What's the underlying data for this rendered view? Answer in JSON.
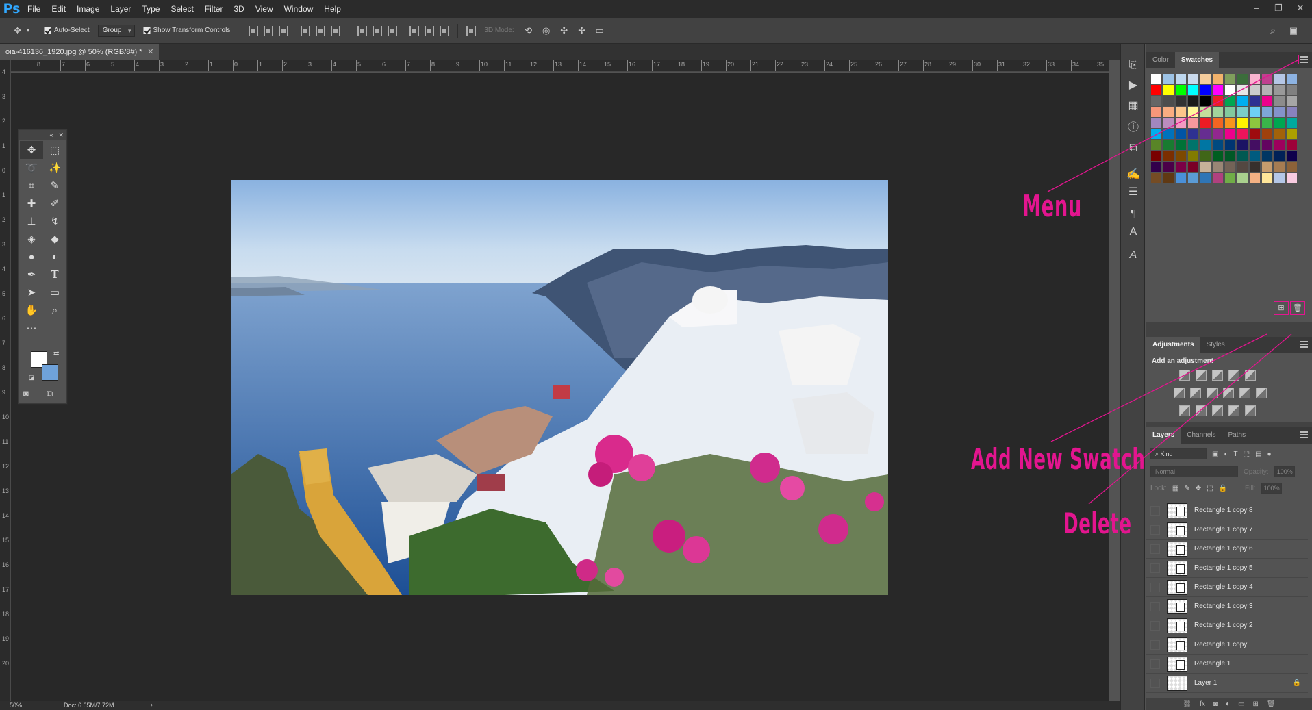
{
  "app": {
    "logo": "Ps"
  },
  "menubar": {
    "items": [
      "File",
      "Edit",
      "Image",
      "Layer",
      "Type",
      "Select",
      "Filter",
      "3D",
      "View",
      "Window",
      "Help"
    ]
  },
  "window_controls": [
    "–",
    "❐",
    "✕"
  ],
  "options_bar": {
    "auto_select_label": "Auto-Select",
    "auto_select_checked": true,
    "group_value": "Group",
    "show_transform_label": "Show Transform Controls",
    "show_transform_checked": true,
    "mode_3d_label": "3D Mode:"
  },
  "document": {
    "tab_title": "oia-416136_1920.jpg @ 50% (RGB/8#) *",
    "zoom": "50%",
    "doc_size": "Doc: 6.65M/7.72M"
  },
  "ruler": {
    "top_labels": [
      "8",
      "7",
      "6",
      "5",
      "4",
      "3",
      "2",
      "1",
      "0",
      "1",
      "2",
      "3",
      "4",
      "5",
      "6",
      "7",
      "8",
      "9",
      "10",
      "11",
      "12",
      "13",
      "14",
      "15",
      "16",
      "17",
      "18",
      "19",
      "20",
      "21",
      "22",
      "23",
      "24",
      "25",
      "26",
      "27",
      "28",
      "29",
      "30",
      "31",
      "32",
      "33",
      "34",
      "35"
    ],
    "left_labels": [
      "4",
      "3",
      "2",
      "1",
      "0",
      "1",
      "2",
      "3",
      "4",
      "5",
      "6",
      "7",
      "8",
      "9",
      "10",
      "11",
      "12",
      "13",
      "14",
      "15",
      "16",
      "17",
      "18",
      "19",
      "20"
    ]
  },
  "colors": {
    "foreground": "#ffffff",
    "background": "#6fa2da",
    "annotation": "#e3158f"
  },
  "swatches_panel": {
    "tabs": [
      "Color",
      "Swatches"
    ],
    "active_tab": "Swatches",
    "swatches": [
      "#ffffff",
      "#9dc3e6",
      "#bdd7ee",
      "#c9d9ec",
      "#f4cc9c",
      "#f2b26b",
      "#7f9e5c",
      "#3b6d3b",
      "#f8b4cf",
      "#c0408f",
      "#b5c7e6",
      "#8db3e2",
      "#ff0000",
      "#ffff00",
      "#00ff00",
      "#00ffff",
      "#0000ff",
      "#ff00ff",
      "#ffffff",
      "#e6e6e6",
      "#cccccc",
      "#b3b3b3",
      "#999999",
      "#808080",
      "#666666",
      "#4d4d4d",
      "#333333",
      "#1a1a1a",
      "#000000",
      "#ed1c24",
      "#00a651",
      "#00aeef",
      "#2e3192",
      "#ec008c",
      "#8c8c8c",
      "#a6a6a6",
      "#f7977a",
      "#f9ad81",
      "#fdc68a",
      "#fff79a",
      "#c4df9b",
      "#a2d39c",
      "#82ca9d",
      "#7bcdc8",
      "#6ecff6",
      "#7ea7d8",
      "#8493ca",
      "#8882be",
      "#a187be",
      "#bc8dbf",
      "#f49ac2",
      "#f6989d",
      "#ed1c24",
      "#f26522",
      "#f7941d",
      "#fff200",
      "#8dc63f",
      "#39b54a",
      "#00a651",
      "#00a99d",
      "#00aeef",
      "#0072bc",
      "#0054a6",
      "#2e3192",
      "#662d91",
      "#92278f",
      "#ec008c",
      "#ed145b",
      "#9e0b0f",
      "#a0410d",
      "#a3620a",
      "#aba000",
      "#598527",
      "#197b30",
      "#007236",
      "#00746b",
      "#0076a3",
      "#004a80",
      "#003471",
      "#1b1464",
      "#440e62",
      "#630460",
      "#9e005d",
      "#9e0039",
      "#790000",
      "#7b2e00",
      "#7d4900",
      "#827b00",
      "#406618",
      "#005e20",
      "#005826",
      "#005952",
      "#005b7f",
      "#003663",
      "#002157",
      "#0d004c",
      "#32004b",
      "#4b0049",
      "#7b0046",
      "#7a0026",
      "#c7b299",
      "#998675",
      "#736357",
      "#534741",
      "#37302d",
      "#c69c6d",
      "#a67c52",
      "#8c6239",
      "#754c24",
      "#603913",
      "#4a90d9",
      "#5b9bd5",
      "#2f75b5",
      "#b0417f",
      "#70ad47",
      "#a9d08e",
      "#f4b183",
      "#ffe699",
      "#b4c7e7",
      "#f8cbe0"
    ],
    "add_new_swatch_icon": "new-swatch-icon",
    "delete_icon": "trash-icon"
  },
  "adjustments_panel": {
    "tabs": [
      "Adjustments",
      "Styles"
    ],
    "active_tab": "Adjustments",
    "heading": "Add an adjustment"
  },
  "layers_panel": {
    "tabs": [
      "Layers",
      "Channels",
      "Paths"
    ],
    "active_tab": "Layers",
    "filter_kind": "Kind",
    "blend_mode": "Normal",
    "opacity_label": "Opacity:",
    "opacity_value": "100%",
    "lock_label": "Lock:",
    "fill_label": "Fill:",
    "fill_value": "100%",
    "layers": [
      {
        "name": "Rectangle 1 copy 8",
        "kind": "shape"
      },
      {
        "name": "Rectangle 1 copy 7",
        "kind": "shape"
      },
      {
        "name": "Rectangle 1 copy 6",
        "kind": "shape"
      },
      {
        "name": "Rectangle 1 copy 5",
        "kind": "shape"
      },
      {
        "name": "Rectangle 1 copy 4",
        "kind": "shape"
      },
      {
        "name": "Rectangle 1 copy 3",
        "kind": "shape"
      },
      {
        "name": "Rectangle 1 copy 2",
        "kind": "shape"
      },
      {
        "name": "Rectangle 1 copy",
        "kind": "shape"
      },
      {
        "name": "Rectangle 1",
        "kind": "shape"
      },
      {
        "name": "Layer 1",
        "kind": "pixel",
        "locked": true
      }
    ]
  },
  "annotations": {
    "menu": "Menu",
    "add_new_swatch": "Add New Swatch",
    "delete": "Delete"
  }
}
